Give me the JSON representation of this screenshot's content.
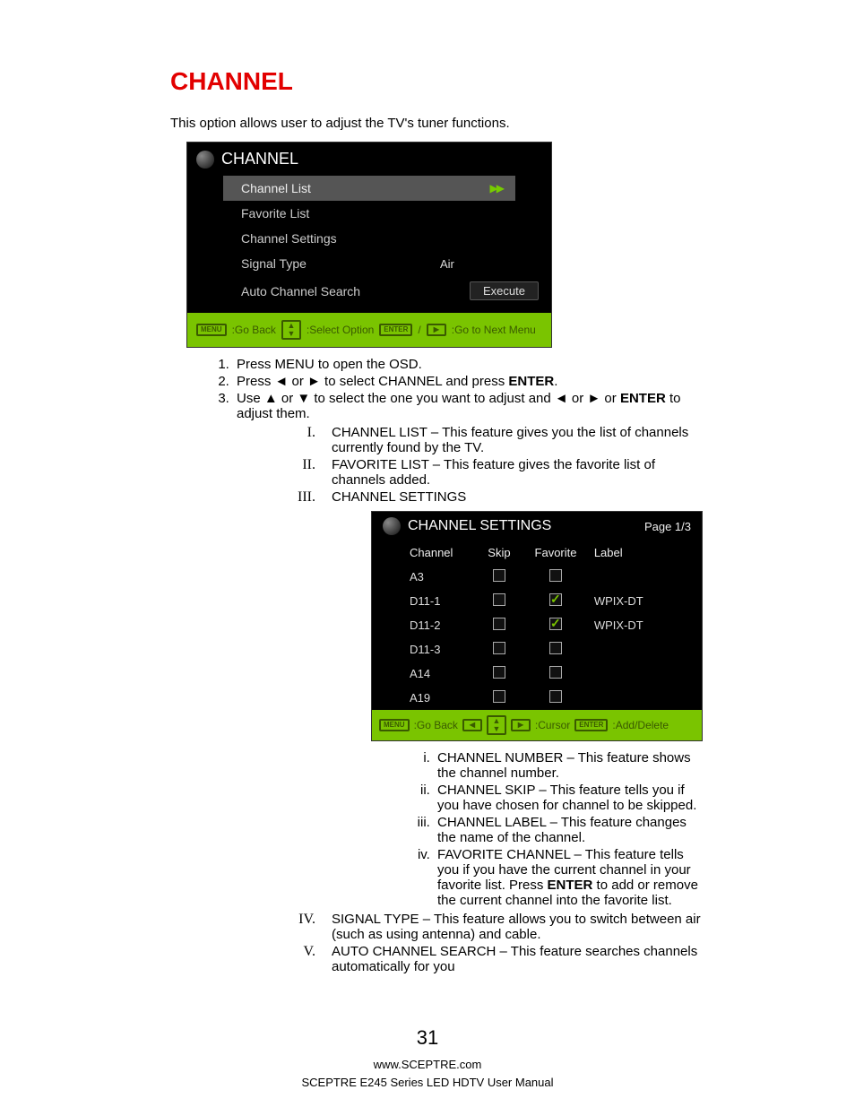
{
  "title": "CHANNEL",
  "intro": "This option allows user to adjust the TV's tuner functions.",
  "osd1": {
    "title": "CHANNEL",
    "rows": [
      {
        "label": "Channel List",
        "selected": true,
        "arrows": true
      },
      {
        "label": "Favorite List"
      },
      {
        "label": "Channel Settings"
      },
      {
        "label": "Signal Type",
        "value": "Air"
      },
      {
        "label": "Auto Channel Search",
        "button": "Execute"
      }
    ],
    "footer": {
      "menu": "MENU",
      "go_back": ":Go Back",
      "select": ":Select Option",
      "enter": "ENTER",
      "next": ":Go to Next Menu"
    }
  },
  "steps": {
    "s1": "Press MENU to open the OSD.",
    "s2_a": "Press ◄ or ► to select CHANNEL and press ",
    "s2_b": "ENTER",
    "s2_c": ".",
    "s3_a": "Use ▲ or ▼ to select the one you want to adjust and ◄ or ► or ",
    "s3_b": "ENTER",
    "s3_c": " to adjust them."
  },
  "roman": {
    "r1": "CHANNEL LIST – This feature gives you the list of channels currently found by the TV.",
    "r2": "FAVORITE LIST – This feature gives the favorite list of channels added.",
    "r3": "CHANNEL SETTINGS",
    "r4": "SIGNAL TYPE – This feature allows you to switch between air (such as using antenna) and cable.",
    "r5": "AUTO CHANNEL SEARCH – This feature searches channels automatically for you"
  },
  "osd2": {
    "title": "CHANNEL SETTINGS",
    "page": "Page 1/3",
    "cols": {
      "c1": "Channel",
      "c2": "Skip",
      "c3": "Favorite",
      "c4": "Label"
    },
    "rows": [
      {
        "ch": "A3",
        "skip": false,
        "fav": false,
        "label": ""
      },
      {
        "ch": "D11-1",
        "skip": false,
        "fav": true,
        "label": "WPIX-DT"
      },
      {
        "ch": "D11-2",
        "skip": false,
        "fav": true,
        "label": "WPIX-DT"
      },
      {
        "ch": "D11-3",
        "skip": false,
        "fav": false,
        "label": ""
      },
      {
        "ch": "A14",
        "skip": false,
        "fav": false,
        "label": ""
      },
      {
        "ch": "A19",
        "skip": false,
        "fav": false,
        "label": ""
      }
    ],
    "footer": {
      "menu": "MENU",
      "go_back": ":Go Back",
      "cursor": ":Cursor",
      "enter": "ENTER",
      "add": ":Add/Delete"
    }
  },
  "lroman": {
    "l1": "CHANNEL NUMBER – This feature shows the channel number.",
    "l2": "CHANNEL SKIP – This feature tells you if you have chosen for channel to be skipped.",
    "l3": "CHANNEL LABEL – This feature changes the name of the channel.",
    "l4_a": "FAVORITE CHANNEL – This feature tells you if you have the current channel in your favorite list. Press ",
    "l4_b": "ENTER",
    "l4_c": " to add or remove the current channel into the favorite list."
  },
  "footer": {
    "page": "31",
    "url": "www.SCEPTRE.com",
    "manual": "SCEPTRE E245 Series LED HDTV User Manual"
  }
}
